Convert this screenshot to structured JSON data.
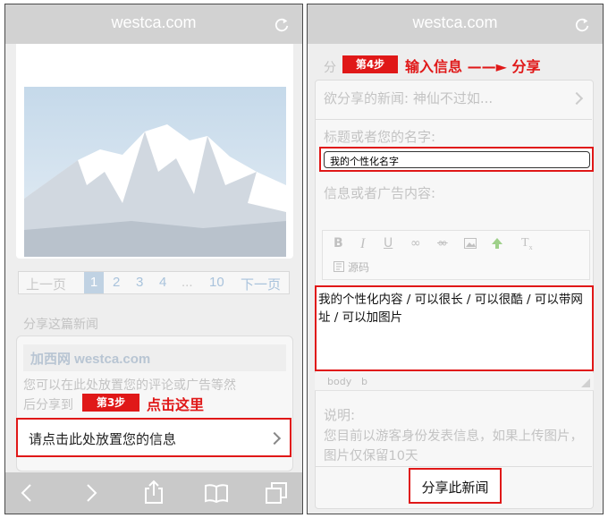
{
  "left": {
    "url": "westca.com",
    "pager": {
      "prev": "上一页",
      "pages": [
        "1",
        "2",
        "3",
        "4",
        "...",
        "10"
      ],
      "next": "下一页"
    },
    "share_heading": "分享这篇新闻",
    "site_name": "加西网 westca.com",
    "desc_line1": "您可以在此处放置您的评论或广告等然",
    "desc_line2": "后分享到",
    "step_badge": "第3步",
    "step_callout": "点击这里",
    "action_label": "请点击此处放置您的信息"
  },
  "right": {
    "url": "westca.com",
    "heading_faded": "分",
    "step_badge": "第4步",
    "step_callout": "输入信息 ——► 分享",
    "news_row": "欲分享的新闻: 神仙不过如...",
    "title_label": "标题或者您的名字:",
    "title_value": "我的个性化名字",
    "content_label": "信息或者广告内容:",
    "source_label": "源码",
    "content_value": "我的个性化内容 / 可以很长 / 可以很酷 / 可以带网址 / 可以加图片",
    "status_body": "body",
    "status_b": "b",
    "note_label": "说明:",
    "note_text": "您目前以游客身份发表信息，如果上传图片，图片仅保留10天",
    "share_button": "分享此新闻"
  }
}
